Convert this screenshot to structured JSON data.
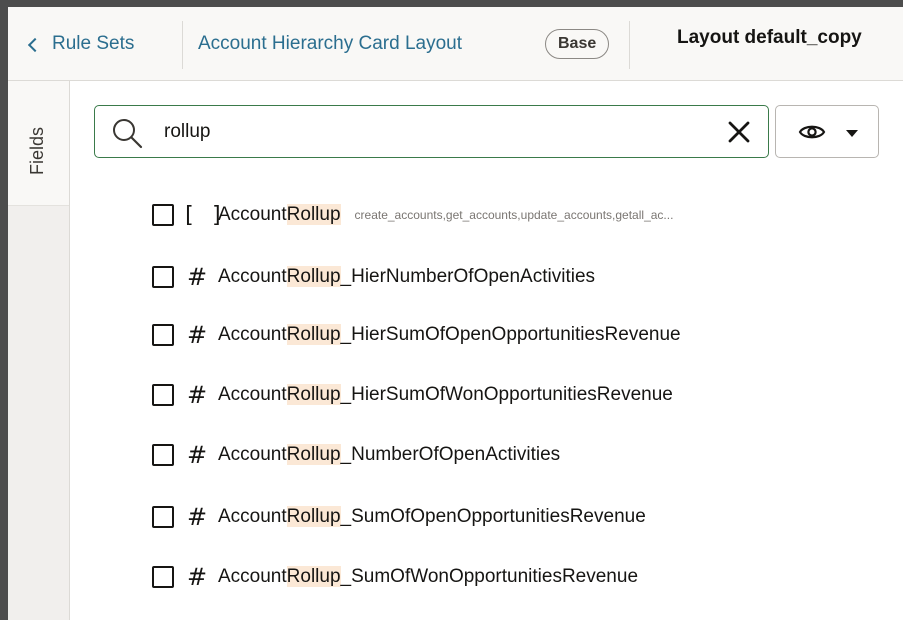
{
  "header": {
    "back_label": "Rule Sets",
    "layout_link": "Account Hierarchy Card Layout",
    "badge": "Base",
    "layout_title": "Layout default_copy"
  },
  "rail": {
    "fields_tab": "Fields"
  },
  "search": {
    "value": "rollup",
    "placeholder": ""
  },
  "fields": [
    {
      "type_icon": "[ ]",
      "prefix": "Account",
      "match": "Rollup",
      "suffix": "",
      "ops": "create_accounts,get_accounts,update_accounts,getall_ac..."
    },
    {
      "type_icon": "#",
      "prefix": "Account",
      "match": "Rollup",
      "suffix": "_HierNumberOfOpenActivities"
    },
    {
      "type_icon": "#",
      "prefix": "Account",
      "match": "Rollup",
      "suffix": "_HierSumOfOpenOpportunitiesRevenue"
    },
    {
      "type_icon": "#",
      "prefix": "Account",
      "match": "Rollup",
      "suffix": "_HierSumOfWonOpportunitiesRevenue"
    },
    {
      "type_icon": "#",
      "prefix": "Account",
      "match": "Rollup",
      "suffix": "_NumberOfOpenActivities"
    },
    {
      "type_icon": "#",
      "prefix": "Account",
      "match": "Rollup",
      "suffix": "_SumOfOpenOpportunitiesRevenue"
    },
    {
      "type_icon": "#",
      "prefix": "Account",
      "match": "Rollup",
      "suffix": "_SumOfWonOpportunitiesRevenue"
    }
  ],
  "colors": {
    "link": "#2b6e8f",
    "highlight": "#fbe8d6",
    "search_border": "#3a7a4a"
  }
}
